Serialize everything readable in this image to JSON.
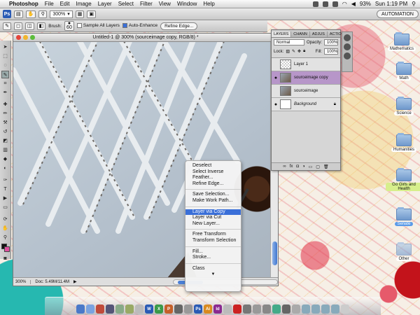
{
  "menubar": {
    "app_name": "Photoshop",
    "items": [
      "File",
      "Edit",
      "Image",
      "Layer",
      "Select",
      "Filter",
      "View",
      "Window",
      "Help"
    ],
    "battery": "93%",
    "clock": "Sun 1:19 PM"
  },
  "options": {
    "zoom": "300%",
    "workspace": "AUTOMATION",
    "brush_label": "Brush:",
    "brush_size": "60",
    "sample_all_layers": "Sample All Layers",
    "auto_enhance": "Auto-Enhance",
    "refine_edge": "Refine Edge..."
  },
  "document": {
    "title": "Untitled-1 @ 300% (sourceimage copy, RGB/8) *",
    "zoom": "300%",
    "doc_size": "Doc: 5.49M/11.4M"
  },
  "layers_panel": {
    "tabs": [
      "LAYERS",
      "CHANN",
      "ADJUS",
      "ACTIO"
    ],
    "blend_mode": "Normal",
    "opacity_label": "Opacity:",
    "opacity": "100%",
    "lock_label": "Lock:",
    "fill_label": "Fill:",
    "fill": "100%",
    "layers": [
      {
        "name": "Layer 1",
        "visible": false
      },
      {
        "name": "sourceimage copy",
        "visible": true
      },
      {
        "name": "sourceimage",
        "visible": false
      },
      {
        "name": "Background",
        "visible": true
      }
    ]
  },
  "context_menu": {
    "groups": [
      [
        "Deselect",
        "Select Inverse",
        "Feather...",
        "Refine Edge..."
      ],
      [
        "Save Selection...",
        "Make Work Path..."
      ],
      [
        "Layer via Copy",
        "Layer via Cut",
        "New Layer..."
      ],
      [
        "Free Transform",
        "Transform Selection"
      ],
      [
        "Fill...",
        "Stroke..."
      ],
      [
        "Class"
      ]
    ],
    "highlighted": "Layer via Copy"
  },
  "desktop_folders": [
    {
      "label": "Mathematics",
      "label_bg": "#ffffff"
    },
    {
      "label": "Math",
      "label_bg": "#ffffff"
    },
    {
      "label": "Science",
      "label_bg": "#ffffff"
    },
    {
      "label": "Humanities",
      "label_bg": "#ffffff"
    },
    {
      "label": "Go Girls and Health",
      "label_bg": "#d7ef8c"
    },
    {
      "label": "Senate",
      "label_bg": "#5b9be8"
    },
    {
      "label": "Other",
      "label_bg": "#ffffff"
    }
  ],
  "colors": {
    "highlight": "#3a6fd8",
    "active_layer": "#b796c9"
  }
}
